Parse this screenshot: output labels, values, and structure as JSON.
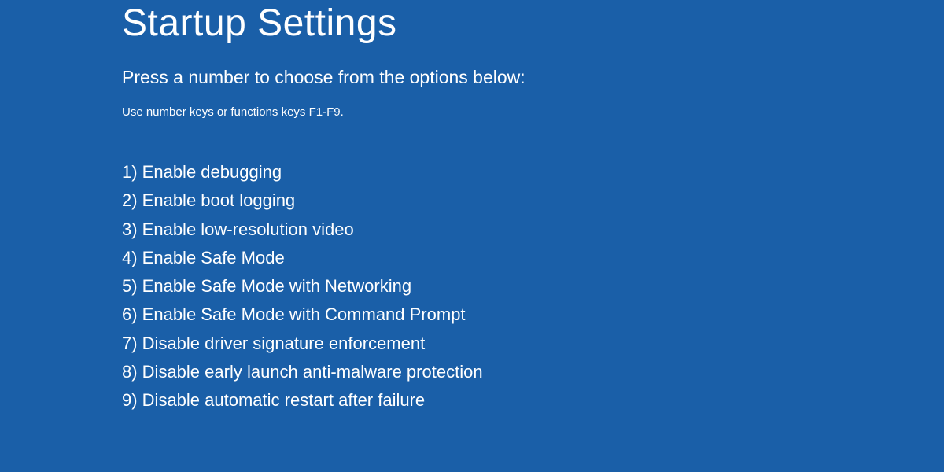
{
  "title": "Startup Settings",
  "instruction": "Press a number to choose from the options below:",
  "hint": "Use number keys or functions keys F1-F9.",
  "options": [
    "1) Enable debugging",
    "2) Enable boot logging",
    "3) Enable low-resolution video",
    "4) Enable Safe Mode",
    "5) Enable Safe Mode with Networking",
    "6) Enable Safe Mode with Command Prompt",
    "7) Disable driver signature enforcement",
    "8) Disable early launch anti-malware protection",
    "9) Disable automatic restart after failure"
  ]
}
